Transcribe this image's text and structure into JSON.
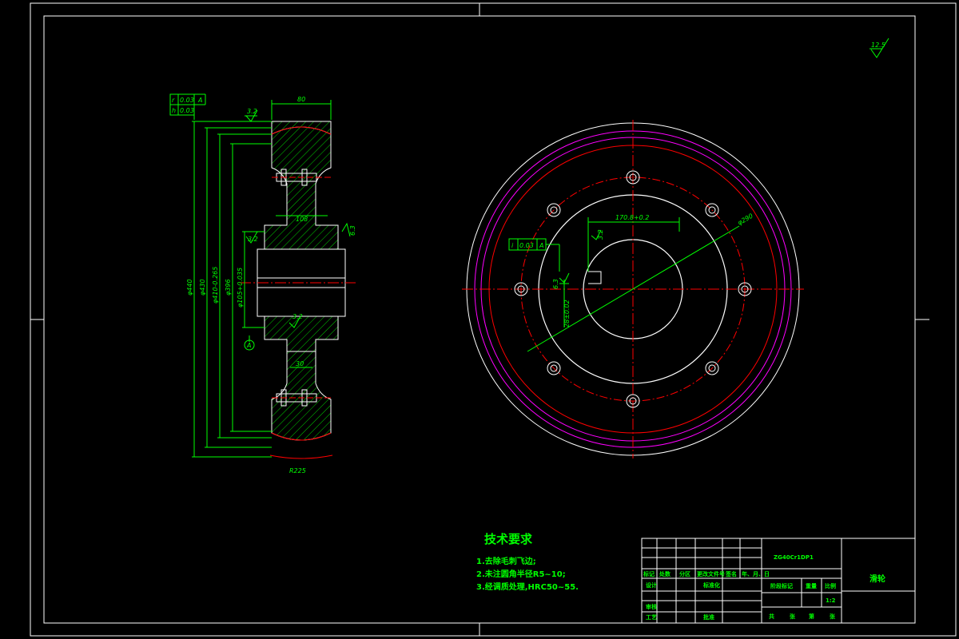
{
  "colors": {
    "background": "#000000",
    "frame": "#ffffff",
    "dimension": "#00ff00",
    "centerline": "#ff0000",
    "outline_magenta": "#ff00ff",
    "hatch": "#00ff00"
  },
  "roughness_general": "12.5",
  "section_view": {
    "width_dim": "80",
    "hub_dim": "108",
    "web_dim": "30",
    "groove_dim": "R225",
    "datum": "A",
    "diameters": [
      "φ440",
      "φ430",
      "φ410-0.265",
      "φ396",
      "φ105+0.035"
    ],
    "tol_r": "r",
    "tol_r_val": "0.03",
    "tol_r_ref": "A",
    "tol_h": "h",
    "tol_h_val": "0.03",
    "rough_1": "3.2",
    "rough_2": "3.2",
    "rough_3": "6.3",
    "rough_4": "3.2"
  },
  "front_view": {
    "bolt_circle": "φ290",
    "keyway_dim": "170.8+0.2",
    "key_width": "28±0.02",
    "tol_sym": "i",
    "tol_sym_val": "0.03",
    "tol_sym_ref": "A",
    "rough_a": "3.2",
    "rough_b": "6.3"
  },
  "technical_requirements": {
    "title": "技术要求",
    "items": [
      "1.去除毛刺飞边;",
      "2.未注圆角半径R5~10;",
      "3.经调质处理,HRC50~55."
    ]
  },
  "title_block": {
    "material": "ZG40Cr1DP1",
    "part_name": "滑轮",
    "header_cells": [
      "标记",
      "处数",
      "分区",
      "更改文件号",
      "签名",
      "年、月、日"
    ],
    "row_design": "设计",
    "row_std": "标准化",
    "row_check": "审核",
    "row_process": "工艺",
    "row_approve": "批准",
    "stage_label": "阶段标记",
    "weight_label": "重量",
    "scale_label": "比例",
    "scale_value": "1:2",
    "sheet_total": "共",
    "sheet_zhang": "张",
    "sheet_di": "第",
    "sheet_zhang2": "张"
  }
}
